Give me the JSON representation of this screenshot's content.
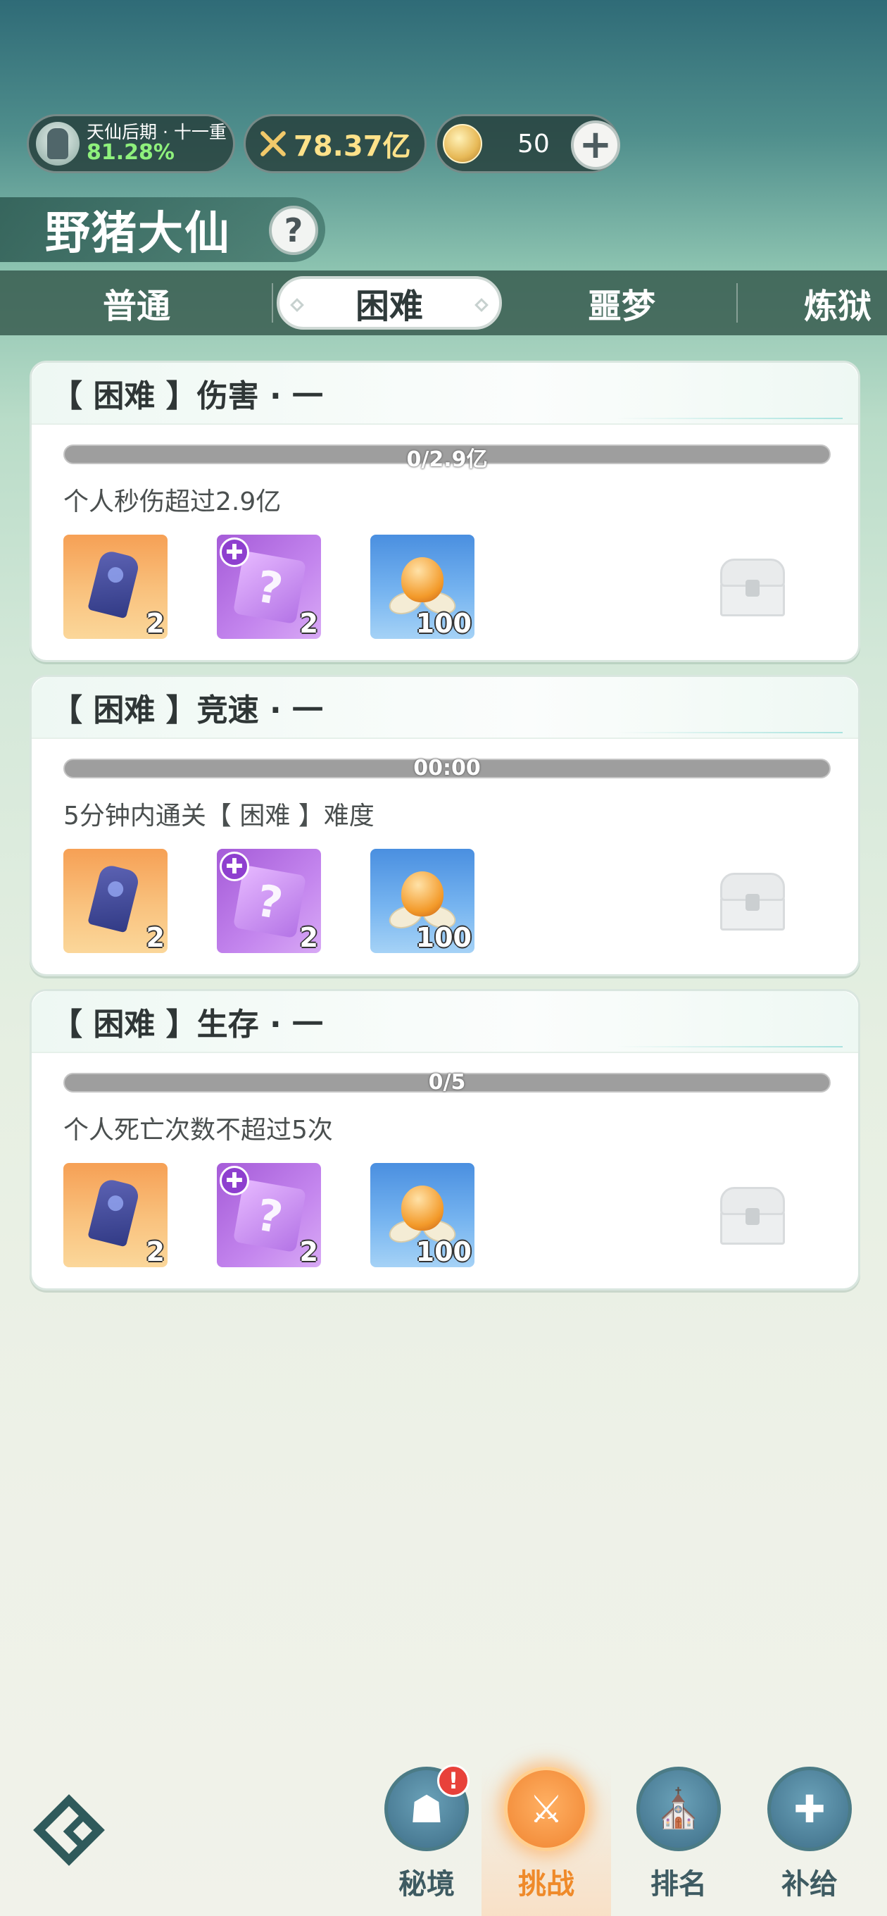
{
  "status": {
    "realm_title": "天仙后期 · 十一重",
    "realm_percent": "81.28%",
    "power": "78.37亿",
    "coins": "50",
    "add_symbol": "+"
  },
  "title": {
    "text": "野猪大仙",
    "help_symbol": "?"
  },
  "tabs": [
    {
      "label": "普通",
      "active": false
    },
    {
      "label": "困难",
      "active": true
    },
    {
      "label": "噩梦",
      "active": false
    },
    {
      "label": "炼狱",
      "active": false
    }
  ],
  "challenges": [
    {
      "title": "【 困难 】伤害 · 一",
      "progress_text": "0/2.9亿",
      "progress": 0,
      "description": "个人秒伤超过2.9亿",
      "rewards": [
        {
          "icon": "crystal-icon",
          "qty": "2"
        },
        {
          "icon": "mystery-box-icon",
          "qty": "2"
        },
        {
          "icon": "lotus-icon",
          "qty": "100"
        }
      ]
    },
    {
      "title": "【 困难 】竞速 · 一",
      "progress_text": "00:00",
      "progress": 0,
      "description": "5分钟内通关【 困难 】难度",
      "rewards": [
        {
          "icon": "crystal-icon",
          "qty": "2"
        },
        {
          "icon": "mystery-box-icon",
          "qty": "2"
        },
        {
          "icon": "lotus-icon",
          "qty": "100"
        }
      ]
    },
    {
      "title": "【 困难 】生存 · 一",
      "progress_text": "0/5",
      "progress": 0,
      "description": "个人死亡次数不超过5次",
      "rewards": [
        {
          "icon": "crystal-icon",
          "qty": "2"
        },
        {
          "icon": "mystery-box-icon",
          "qty": "2"
        },
        {
          "icon": "lotus-icon",
          "qty": "100"
        }
      ]
    }
  ],
  "nav": [
    {
      "label": "秘境",
      "icon": "demon-mask-icon",
      "alert": "!"
    },
    {
      "label": "挑战",
      "icon": "swords-icon",
      "active": true
    },
    {
      "label": "排名",
      "icon": "ranking-icon"
    },
    {
      "label": "补给",
      "icon": "supply-icon"
    }
  ],
  "colors": {
    "accent_active": "#ef8a2a",
    "progress_track": "#9e9e9e",
    "alert": "#e8413a"
  }
}
